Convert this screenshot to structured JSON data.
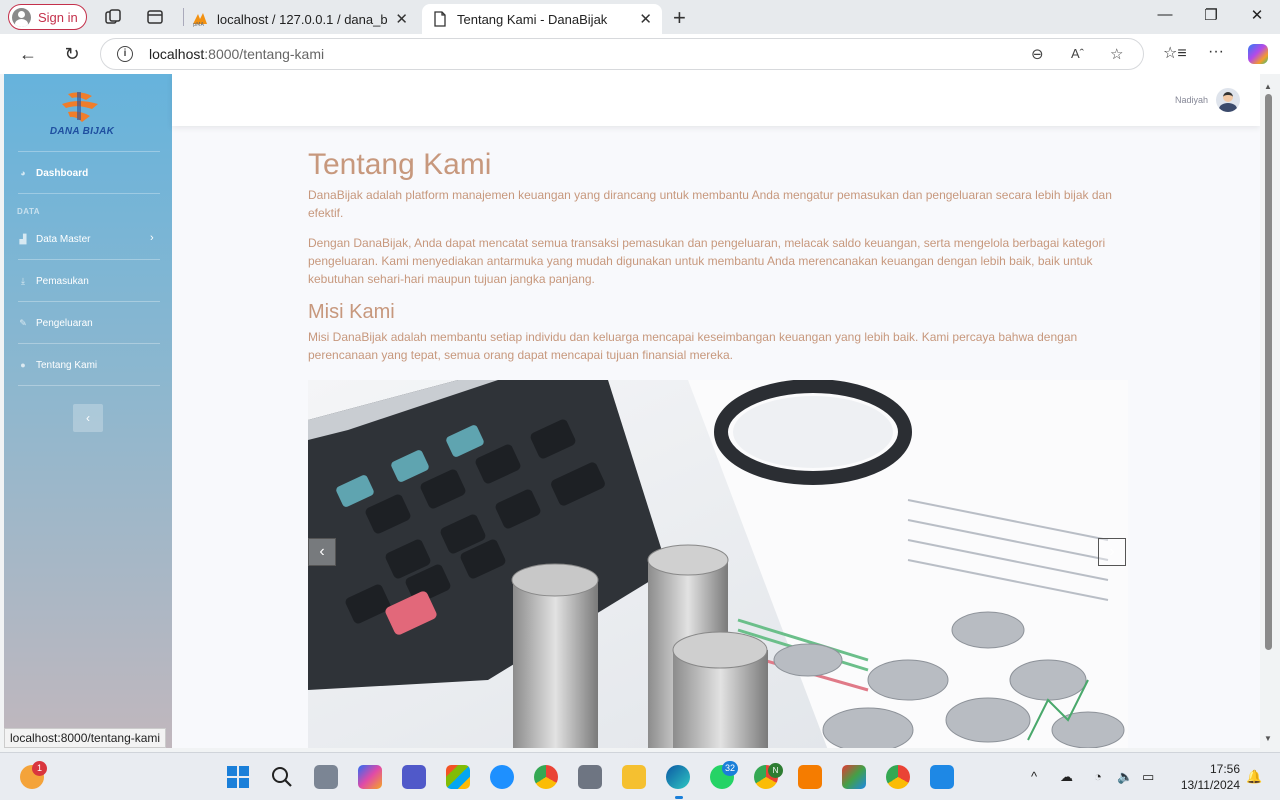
{
  "browser": {
    "signin_label": "Sign in",
    "tabs": [
      {
        "title": "localhost / 127.0.0.1 / dana_bijak",
        "favicon": "phpmyadmin-icon",
        "active": false
      },
      {
        "title": "Tentang Kami - DanaBijak",
        "favicon": "page-icon",
        "active": true
      }
    ],
    "url_host": "localhost",
    "url_rest": ":8000/tentang-kami",
    "status_tip": "localhost:8000/tentang-kami"
  },
  "sidebar": {
    "brand": "DANA BIJAK",
    "dashboard_label": "Dashboard",
    "section_heading": "DATA",
    "items": [
      {
        "label": "Data Master",
        "icon": "chart-icon",
        "has_chevron": true
      },
      {
        "label": "Pemasukan",
        "icon": "download-icon"
      },
      {
        "label": "Pengeluaran",
        "icon": "edit-icon"
      },
      {
        "label": "Tentang Kami",
        "icon": "info-icon"
      }
    ]
  },
  "topbar": {
    "user_name": "Nadiyah"
  },
  "page": {
    "title": "Tentang Kami",
    "intro": "DanaBijak adalah platform manajemen keuangan yang dirancang untuk membantu Anda mengatur pemasukan dan pengeluaran secara lebih bijak dan efektif.",
    "paragraph2": "Dengan DanaBijak, Anda dapat mencatat semua transaksi pemasukan dan pengeluaran, melacak saldo keuangan, serta mengelola berbagai kategori pengeluaran. Kami menyediakan antarmuka yang mudah digunakan untuk membantu Anda merencanakan keuangan dengan lebih baik, baik untuk kebutuhan sehari-hari maupun tujuan jangka panjang.",
    "mission_heading": "Misi Kami",
    "mission_text": "Misi DanaBijak adalah membantu setiap individu dan keluarga mencapai keseimbangan keuangan yang lebih baik. Kami percaya bahwa dengan perencanaan yang tepat, semua orang dapat mencapai tujuan finansial mereka.",
    "carousel_image": "calculator-coins-magnifier-photo"
  },
  "taskbar": {
    "weather_badge": "1",
    "whatsapp_badge": "32",
    "chrome_profile_badge": "N",
    "time": "17:56",
    "date": "13/11/2024"
  },
  "colors": {
    "accent_text": "#c7987d",
    "sidebar_top": "#66b3dc",
    "sidebar_bottom": "#c1b7bd",
    "signin_border": "#c4314b"
  }
}
